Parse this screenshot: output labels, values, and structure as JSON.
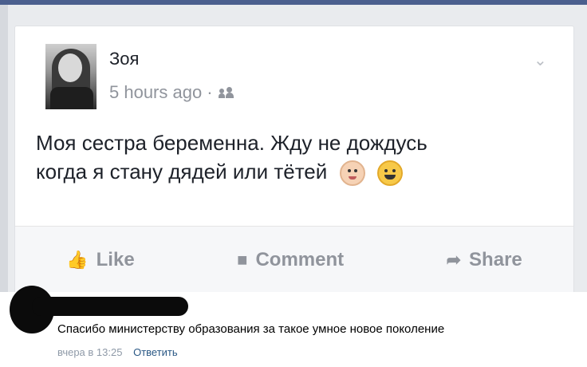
{
  "post": {
    "author": "Зоя",
    "time": "5 hours ago ·",
    "audience_icon": "friends-icon",
    "text_line1": "Моя сестра беременна. Жду не дождусь",
    "text_line2": "когда я стану дядей или тётей",
    "actions": {
      "like": "Like",
      "comment": "Comment",
      "share": "Share"
    }
  },
  "comment": {
    "text": "Спасибо министерству образования за такое умное новое поколение",
    "time": "вчера в 13:25",
    "reply": "Ответить"
  },
  "colors": {
    "link": "#2a5885",
    "muted": "#90949c",
    "top_bar": "#4b5f8e"
  }
}
